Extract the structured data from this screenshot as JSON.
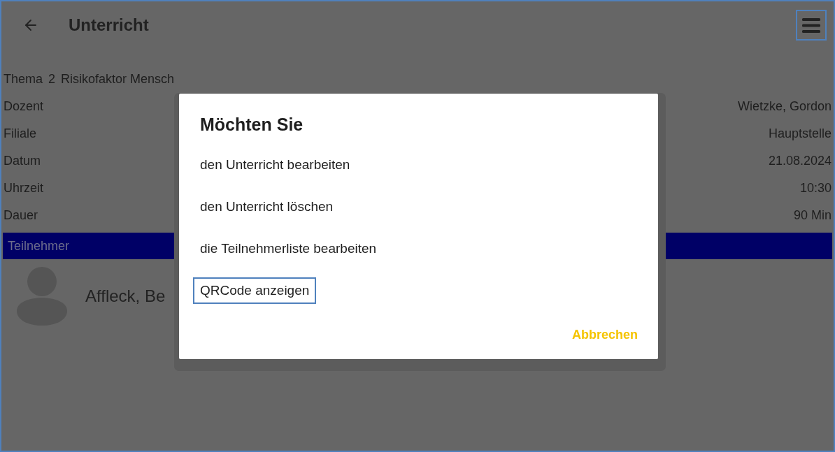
{
  "app_bar": {
    "title": "Unterricht",
    "menu_button": {
      "focused": true
    }
  },
  "details": {
    "topic": {
      "label": "Thema",
      "number": "2",
      "title": "Risikofaktor Mensch"
    },
    "rows": [
      {
        "label": "Dozent",
        "value": "Wietzke, Gordon"
      },
      {
        "label": "Filiale",
        "value": "Hauptstelle"
      },
      {
        "label": "Datum",
        "value": "21.08.2024"
      },
      {
        "label": "Uhrzeit",
        "value": "10:30"
      },
      {
        "label": "Dauer",
        "value": "90 Min"
      }
    ]
  },
  "participants": {
    "header": "Teilnehmer",
    "items": [
      {
        "name": "Affleck, Be"
      }
    ]
  },
  "dialog": {
    "title": "Möchten Sie",
    "options": [
      {
        "label": "den Unterricht bearbeiten",
        "focused": false
      },
      {
        "label": "den Unterricht löschen",
        "focused": false
      },
      {
        "label": "die Teilnehmerliste bearbeiten",
        "focused": false
      },
      {
        "label": "QRCode anzeigen",
        "focused": true
      }
    ],
    "cancel": "Abbrechen"
  }
}
